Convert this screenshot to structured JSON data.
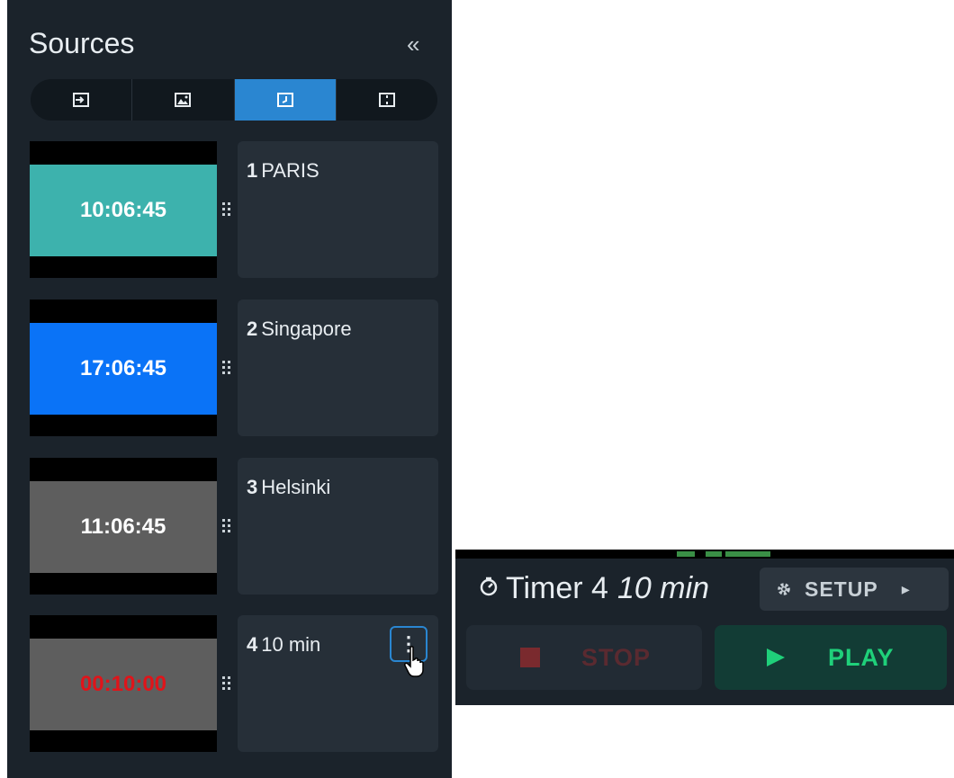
{
  "panel": {
    "title": "Sources",
    "collapse_glyph": "«",
    "tabs": [
      {
        "icon": "input-icon",
        "active": false
      },
      {
        "icon": "image-icon",
        "active": false
      },
      {
        "icon": "clock-icon",
        "active": true
      },
      {
        "icon": "layout-icon",
        "active": false
      }
    ]
  },
  "sources": [
    {
      "number": "1",
      "name": "PARIS",
      "time": "10:06:45",
      "bg": "#3db2ad",
      "fg": "#ffffff"
    },
    {
      "number": "2",
      "name": "Singapore",
      "time": "17:06:45",
      "bg": "#0a73f7",
      "fg": "#ffffff"
    },
    {
      "number": "3",
      "name": "Helsinki",
      "time": "11:06:45",
      "bg": "#5e5e5e",
      "fg": "#ffffff"
    },
    {
      "number": "4",
      "name": "10 min",
      "time": "00:10:00",
      "bg": "#5e5e5e",
      "fg": "#e0141a"
    }
  ],
  "control": {
    "title": "Timer 4",
    "subtitle": "10 min",
    "setup_label": "SETUP",
    "stop_label": "STOP",
    "play_label": "PLAY"
  },
  "colors": {
    "accent": "#2a86d1",
    "play": "#1fd07a",
    "stop": "#7a2a2e"
  }
}
